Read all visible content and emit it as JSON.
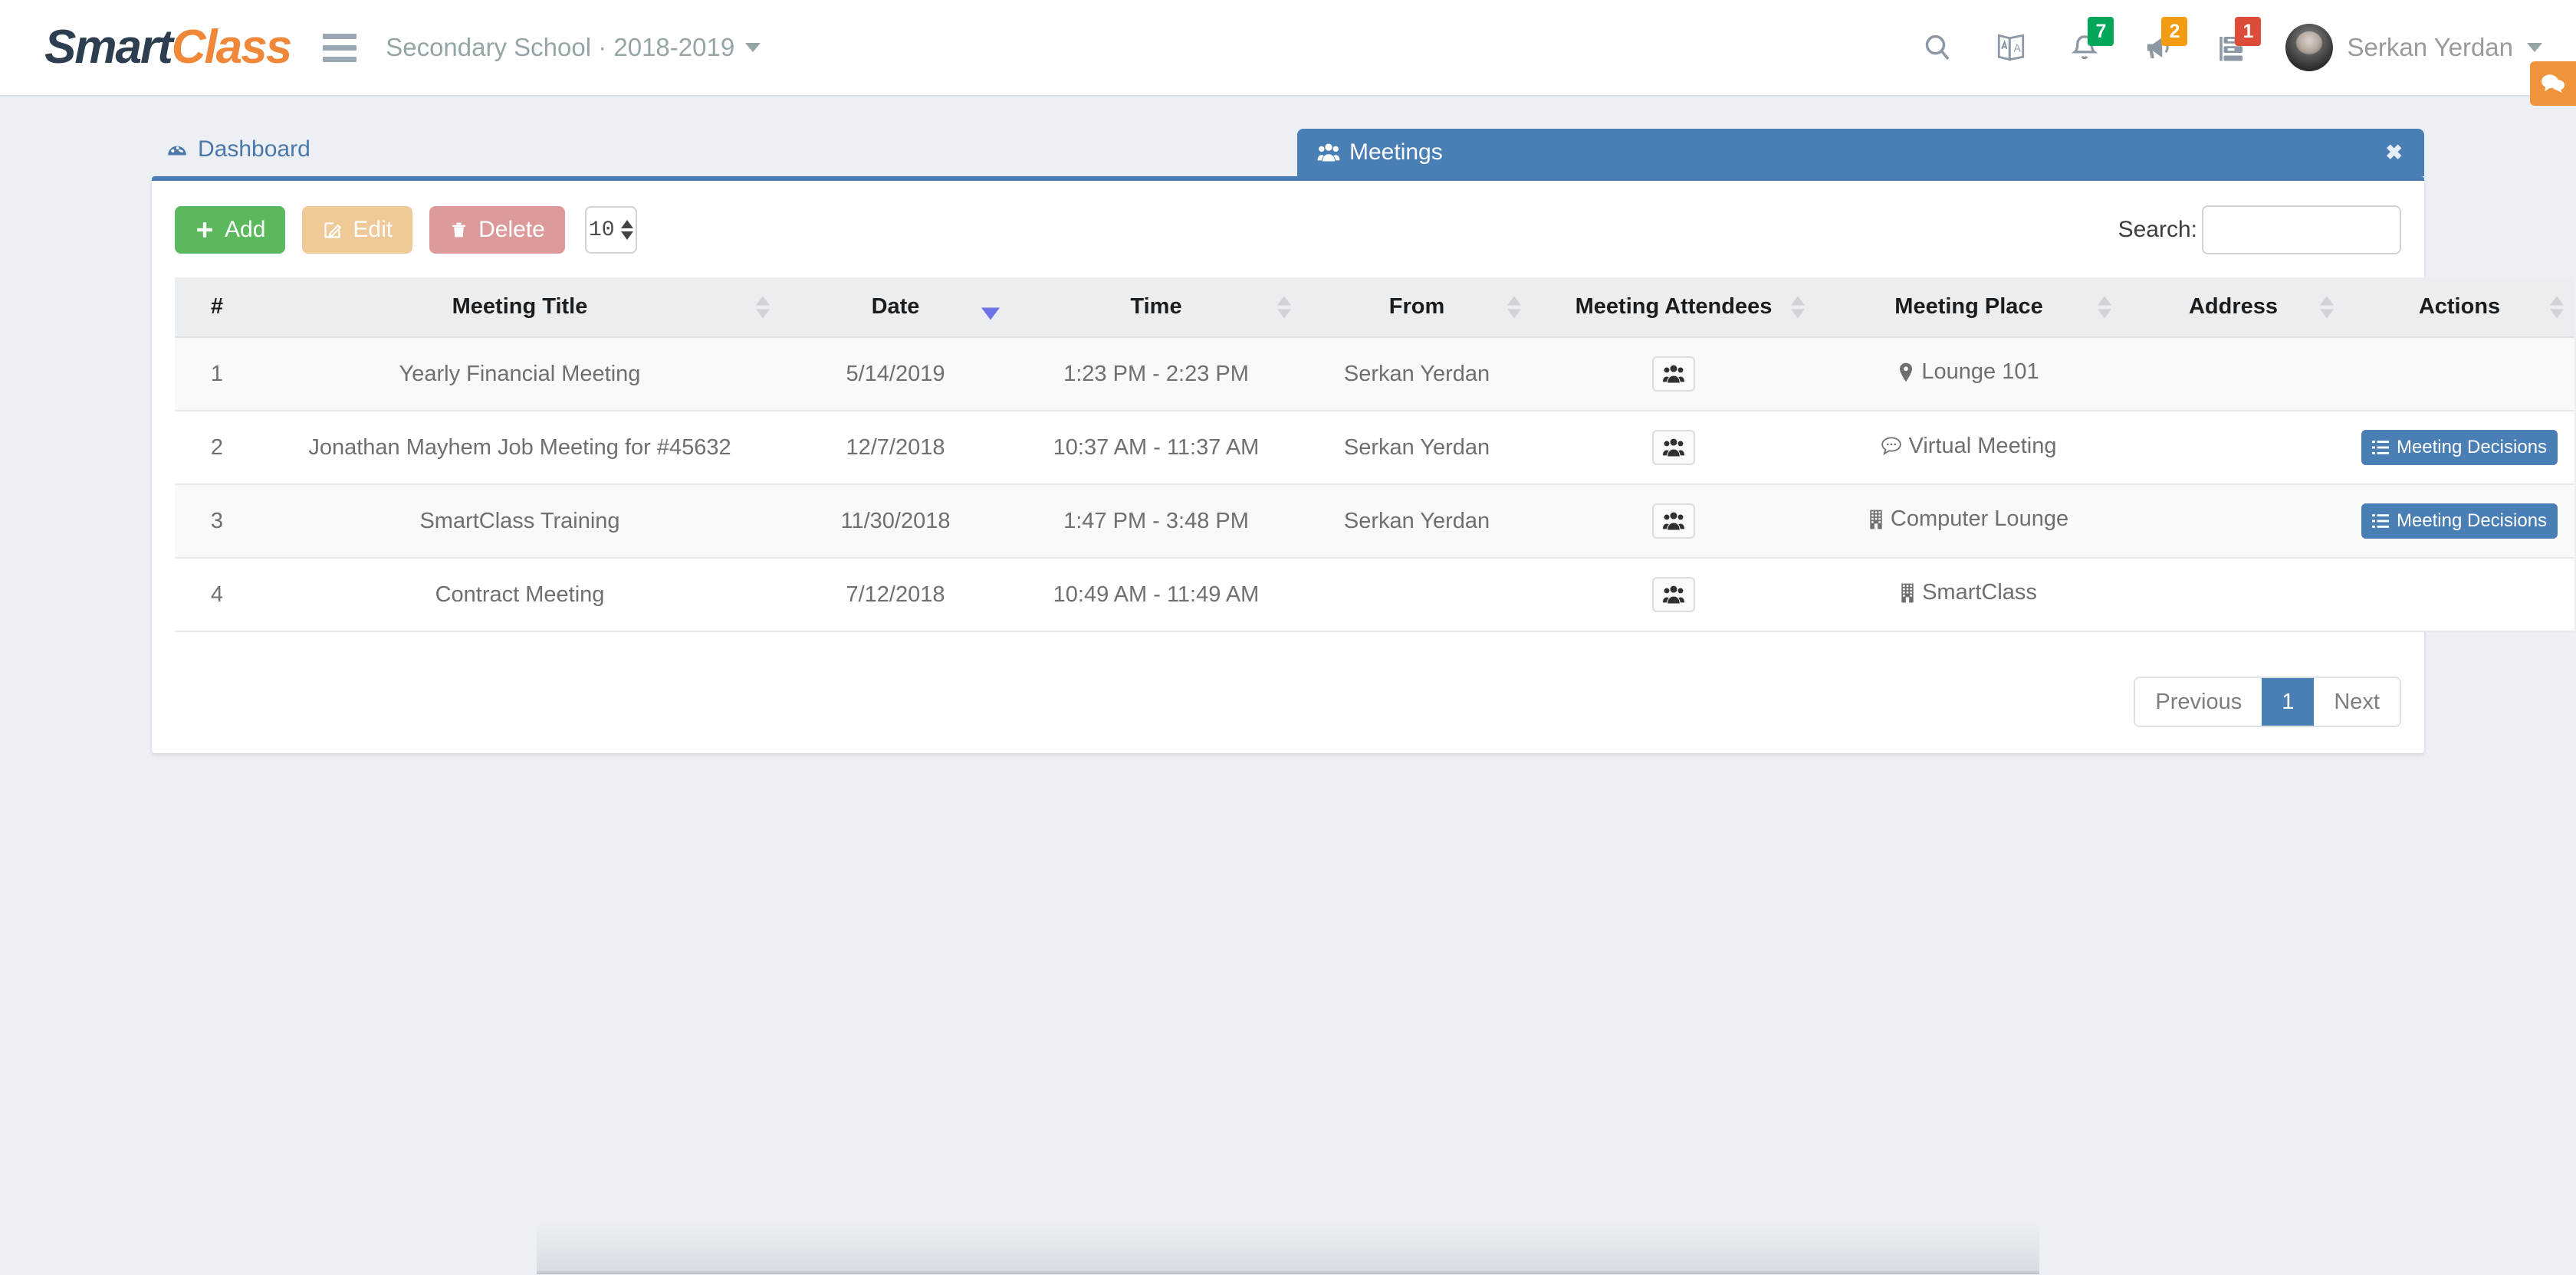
{
  "navbar": {
    "brand_first": "Smart",
    "brand_second": "Class",
    "menu_toggle_name": "hamburger-menu",
    "school_selector": "Secondary School · 2018-2019",
    "icons": {
      "search": "search-icon",
      "translate": "translate-icon",
      "bell": "bell-icon",
      "megaphone": "megaphone-icon",
      "tasks": "tasks-icon"
    },
    "badges": {
      "notifications": "7",
      "announcements": "2",
      "tasks": "1"
    },
    "user_name": "Serkan Yerdan",
    "chat_icon": "chat-bubble-icon"
  },
  "tabs": {
    "dashboard": "Dashboard",
    "active": "Meetings",
    "close_label": "✖"
  },
  "toolbar": {
    "add_label": "Add",
    "edit_label": "Edit",
    "delete_label": "Delete",
    "page_length": "10",
    "search_label": "Search:",
    "search_value": "",
    "search_placeholder": ""
  },
  "table": {
    "columns": [
      {
        "key": "num",
        "label": "#",
        "sortable": false,
        "sort": "none"
      },
      {
        "key": "title",
        "label": "Meeting Title",
        "sortable": true,
        "sort": "none"
      },
      {
        "key": "date",
        "label": "Date",
        "sortable": true,
        "sort": "desc"
      },
      {
        "key": "time",
        "label": "Time",
        "sortable": true,
        "sort": "none"
      },
      {
        "key": "from",
        "label": "From",
        "sortable": true,
        "sort": "none"
      },
      {
        "key": "att",
        "label": "Meeting Attendees",
        "sortable": true,
        "sort": "none"
      },
      {
        "key": "place",
        "label": "Meeting Place",
        "sortable": true,
        "sort": "none"
      },
      {
        "key": "addr",
        "label": "Address",
        "sortable": true,
        "sort": "none"
      },
      {
        "key": "act",
        "label": "Actions",
        "sortable": true,
        "sort": "none"
      }
    ],
    "rows": [
      {
        "num": "1",
        "title": "Yearly Financial Meeting",
        "date": "5/14/2019",
        "time": "1:23 PM - 2:23 PM",
        "from": "Serkan Yerdan",
        "attendees_icon": "users-icon",
        "place": "Lounge 101",
        "place_icon": "map-marker-icon",
        "address": "",
        "action_label": ""
      },
      {
        "num": "2",
        "title": "Jonathan Mayhem Job Meeting for #45632",
        "date": "12/7/2018",
        "time": "10:37 AM - 11:37 AM",
        "from": "Serkan Yerdan",
        "attendees_icon": "users-icon",
        "place": "Virtual Meeting",
        "place_icon": "comment-icon",
        "address": "",
        "action_label": "Meeting Decisions"
      },
      {
        "num": "3",
        "title": "SmartClass Training",
        "date": "11/30/2018",
        "time": "1:47 PM - 3:48 PM",
        "from": "Serkan Yerdan",
        "attendees_icon": "users-icon",
        "place": "Computer Lounge",
        "place_icon": "building-icon",
        "address": "",
        "action_label": "Meeting Decisions"
      },
      {
        "num": "4",
        "title": "Contract Meeting",
        "date": "7/12/2018",
        "time": "10:49 AM - 11:49 AM",
        "from": "",
        "attendees_icon": "users-icon",
        "place": "SmartClass",
        "place_icon": "building-icon",
        "address": "",
        "action_label": ""
      }
    ]
  },
  "pagination": {
    "previous": "Previous",
    "current_page": "1",
    "next": "Next"
  },
  "colors": {
    "brand_dark": "#2c3e50",
    "brand_orange": "#f0883a",
    "tab_blue": "#4a7fb5",
    "add_green": "#5cb85c",
    "edit_orange": "#f0c999",
    "delete_red": "#dd9a9a",
    "badge_green": "#00a65a",
    "badge_yellow": "#f39c12",
    "badge_red": "#dd4b39",
    "page_bg": "#ecf0f5"
  }
}
